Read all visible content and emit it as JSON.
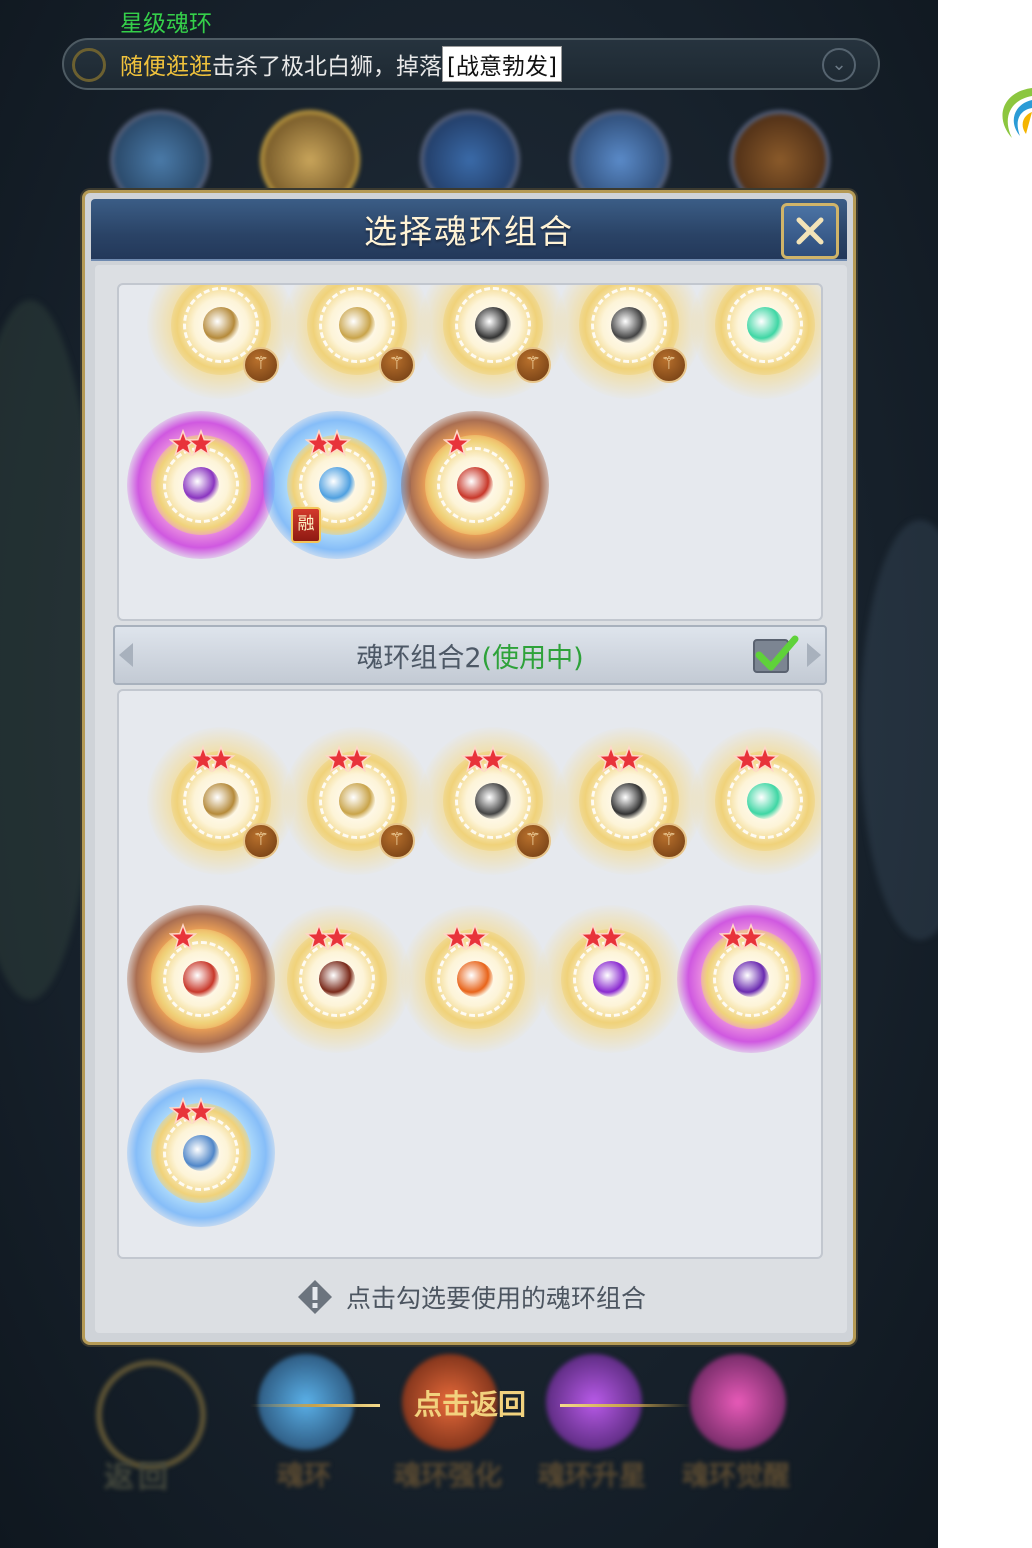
{
  "notice": {
    "player": "随便逛逛",
    "action": "击杀了极北白狮，掉落",
    "item": "星级魂环",
    "tag": "[战意勃发]"
  },
  "dialog": {
    "title": "选择魂环组合",
    "group2": {
      "label": "魂环组合2",
      "status": "(使用中)",
      "selected": true
    },
    "footer_hint": "点击勾选要使用的魂环组合"
  },
  "bottom": {
    "return_hint": "点击返回",
    "back_label": "返回",
    "tabs": [
      "魂环",
      "魂环强化",
      "魂环升星",
      "魂环觉醒"
    ]
  },
  "rings": {
    "group1": [
      {
        "color": "gold",
        "stars": 0,
        "badge": true,
        "emblem": "#b58a3a"
      },
      {
        "color": "gold",
        "stars": 0,
        "badge": true,
        "emblem": "#c9a44a"
      },
      {
        "color": "gold",
        "stars": 0,
        "badge": true,
        "emblem": "#333333"
      },
      {
        "color": "gold",
        "stars": 0,
        "badge": true,
        "emblem": "#444444"
      },
      {
        "color": "gold",
        "stars": 0,
        "badge": false,
        "emblem": "#3fd6a4"
      },
      {
        "color": "purple",
        "stars": 2,
        "badge": false,
        "emblem": "#8a35c0"
      },
      {
        "color": "blue",
        "stars": 2,
        "badge": false,
        "fusion": true,
        "emblem": "#4fa0e0"
      },
      {
        "color": "orange",
        "stars": 1,
        "badge": false,
        "emblem": "#c8382a"
      }
    ],
    "group2": [
      {
        "color": "gold",
        "stars": 2,
        "badge": true,
        "emblem": "#b58a3a"
      },
      {
        "color": "gold",
        "stars": 2,
        "badge": true,
        "emblem": "#c9a44a"
      },
      {
        "color": "gold",
        "stars": 2,
        "badge": true,
        "emblem": "#444444"
      },
      {
        "color": "gold",
        "stars": 2,
        "badge": true,
        "emblem": "#333333"
      },
      {
        "color": "gold",
        "stars": 2,
        "badge": false,
        "emblem": "#3fd6a4"
      },
      {
        "color": "orange",
        "stars": 1,
        "badge": false,
        "emblem": "#c8382a"
      },
      {
        "color": "gold",
        "stars": 2,
        "badge": false,
        "emblem": "#7a2a1a"
      },
      {
        "color": "gold",
        "stars": 2,
        "badge": false,
        "emblem": "#e8641a"
      },
      {
        "color": "gold",
        "stars": 2,
        "badge": false,
        "emblem": "#8a2ad0"
      },
      {
        "color": "purple",
        "stars": 2,
        "badge": false,
        "emblem": "#6a2ab0"
      },
      {
        "color": "blue",
        "stars": 2,
        "badge": false,
        "emblem": "#4f86c8"
      }
    ]
  },
  "colors": {
    "name": "#f0c23c",
    "item": "#35d04a",
    "status": "#2ea23a",
    "title": "#fff3d6"
  }
}
